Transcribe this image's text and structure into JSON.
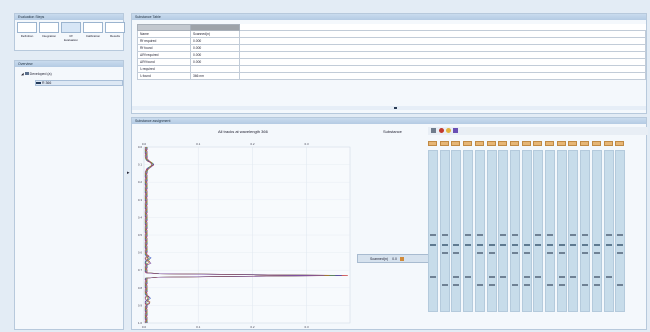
{
  "steps_panel": {
    "title": "Evaluation Steps",
    "steps": [
      {
        "label": "Definition"
      },
      {
        "label": "Integration"
      },
      {
        "label": "Rf\nEvaluation",
        "active": true
      },
      {
        "label": "Calibration"
      },
      {
        "label": "Results"
      }
    ]
  },
  "overview_panel": {
    "title": "Overview",
    "tree": [
      {
        "label": "Developed (a)"
      },
      {
        "label": "R 366"
      }
    ]
  },
  "substance_table": {
    "title": "Substance Table",
    "rows": [
      {
        "label": "Name",
        "value": "Scanned(n)"
      },
      {
        "label": "Rf required",
        "value": "0.000"
      },
      {
        "label": "Rf found",
        "value": "0.000"
      },
      {
        "label": "ΔRf required",
        "value": "0.000"
      },
      {
        "label": "ΔRf found",
        "value": "0.000"
      },
      {
        "label": "λ required",
        "value": ""
      },
      {
        "label": "λ found",
        "value": "366 nm"
      }
    ]
  },
  "assignment_panel": {
    "title": "Substance assignment",
    "chart_title": "All tracks at wavelength 366",
    "substance_label": "Substance",
    "selector_value": "Scanned(n)",
    "selector_step": "0.0"
  },
  "chart_data": {
    "type": "line",
    "title": "All tracks at wavelength 366",
    "x_ticks": [
      "0.0",
      "0.1",
      "0.2",
      "0.3"
    ],
    "y_ticks": [
      "0.0",
      "0.1",
      "0.2",
      "0.3",
      "0.4",
      "0.5",
      "0.6",
      "0.7",
      "0.8",
      "0.9",
      "1.0"
    ],
    "y_ticks_bottom_to_top": [
      "0.9",
      "0.8",
      "0.7",
      "0.6",
      "0.5",
      "0.4",
      "0.3",
      "0.2",
      "0.1",
      "0.0"
    ],
    "xlim": [
      0,
      0.38
    ],
    "ylim": [
      0,
      1.0
    ],
    "peak_rf": 0.73,
    "peak_height": 0.37,
    "colors": [
      "#c02020",
      "#3050c0",
      "#60a040",
      "#c07020",
      "#8050a0"
    ]
  },
  "toolbar_icons": [
    "print-icon",
    "undo-icon",
    "settings-icon",
    "assign-icon"
  ],
  "plates": {
    "count": 17,
    "bands_rf": [
      0.58,
      0.63,
      0.52,
      0.78,
      0.83
    ]
  }
}
